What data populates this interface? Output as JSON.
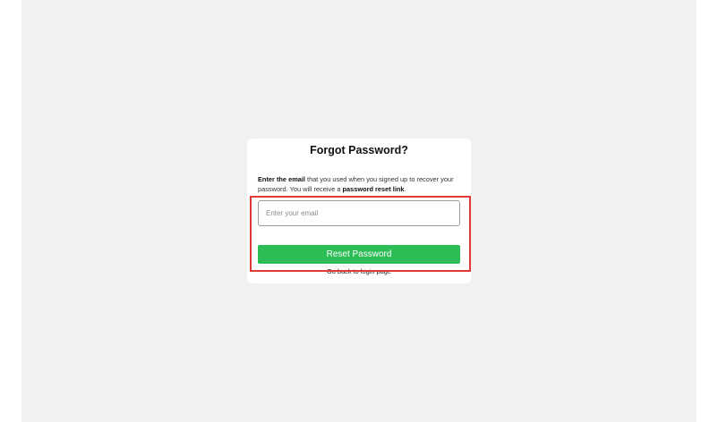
{
  "forgot_password": {
    "title": "Forgot Password?",
    "instructions": {
      "part1_bold": "Enter the email",
      "part2": " that you used when you signed up to recover your password. You will receive a ",
      "part3_bold": "password reset link",
      "part4": "."
    },
    "email_input": {
      "placeholder": "Enter your email",
      "value": ""
    },
    "reset_button_label": "Reset Password",
    "back_link_label": "Go back to login page"
  },
  "colors": {
    "page_background": "#f1f1f1",
    "card_background": "#ffffff",
    "button_green": "#2dbd57",
    "highlight_red": "#e03a35"
  }
}
